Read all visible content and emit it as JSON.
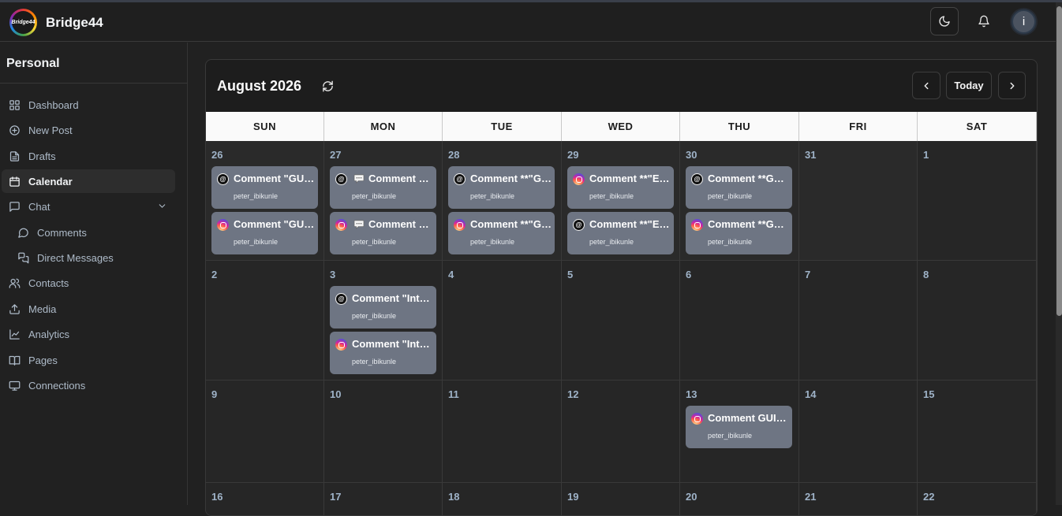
{
  "app": {
    "name": "Bridge44",
    "logo_text": "Bridge44"
  },
  "topbar": {
    "theme_toggle_icon": "moon-icon",
    "notifications_icon": "bell-icon",
    "avatar_initial": "i"
  },
  "sidebar": {
    "workspace": "Personal",
    "items": [
      {
        "label": "Dashboard",
        "icon": "grid-icon",
        "active": false,
        "sub": false
      },
      {
        "label": "New Post",
        "icon": "plus-circle-icon",
        "active": false,
        "sub": false
      },
      {
        "label": "Drafts",
        "icon": "file-icon",
        "active": false,
        "sub": false
      },
      {
        "label": "Calendar",
        "icon": "calendar-icon",
        "active": true,
        "sub": false
      },
      {
        "label": "Chat",
        "icon": "message-square-icon",
        "active": false,
        "sub": false,
        "expandable": true
      },
      {
        "label": "Comments",
        "icon": "message-circle-icon",
        "active": false,
        "sub": true
      },
      {
        "label": "Direct Messages",
        "icon": "messages-icon",
        "active": false,
        "sub": true
      },
      {
        "label": "Contacts",
        "icon": "users-icon",
        "active": false,
        "sub": false
      },
      {
        "label": "Media",
        "icon": "upload-icon",
        "active": false,
        "sub": false
      },
      {
        "label": "Analytics",
        "icon": "chart-line-icon",
        "active": false,
        "sub": false
      },
      {
        "label": "Pages",
        "icon": "book-icon",
        "active": false,
        "sub": false
      },
      {
        "label": "Connections",
        "icon": "monitor-icon",
        "active": false,
        "sub": false
      }
    ]
  },
  "calendar": {
    "month_label": "August 2026",
    "today_label": "Today",
    "weekdays": [
      "SUN",
      "MON",
      "TUE",
      "WED",
      "THU",
      "FRI",
      "SAT"
    ],
    "weeks": [
      [
        {
          "day": "26",
          "other": true,
          "events": [
            {
              "platform": "threads",
              "title": "Comment \"GUIDE",
              "user": "peter_ibikunle",
              "bubble": false
            },
            {
              "platform": "instagram",
              "title": "Comment \"GUIDE",
              "user": "peter_ibikunle",
              "bubble": false
            }
          ]
        },
        {
          "day": "27",
          "other": true,
          "events": [
            {
              "platform": "threads",
              "title": "Comment \"GUIDE",
              "user": "peter_ibikunle",
              "bubble": true
            },
            {
              "platform": "instagram",
              "title": "Comment \"GUIDE",
              "user": "peter_ibikunle",
              "bubble": true
            }
          ]
        },
        {
          "day": "28",
          "other": true,
          "events": [
            {
              "platform": "threads",
              "title": "Comment **\"GUIDE",
              "user": "peter_ibikunle",
              "bubble": false
            },
            {
              "platform": "instagram",
              "title": "Comment **\"GUIDE",
              "user": "peter_ibikunle",
              "bubble": false
            }
          ]
        },
        {
          "day": "29",
          "other": true,
          "events": [
            {
              "platform": "instagram",
              "title": "Comment **\"EXAMPLE",
              "user": "peter_ibikunle",
              "bubble": false
            },
            {
              "platform": "threads",
              "title": "Comment **\"EXAMPLE",
              "user": "peter_ibikunle",
              "bubble": false
            }
          ]
        },
        {
          "day": "30",
          "other": true,
          "events": [
            {
              "platform": "threads",
              "title": "Comment **GUIDE",
              "user": "peter_ibikunle",
              "bubble": false
            },
            {
              "platform": "instagram",
              "title": "Comment **GUIDE",
              "user": "peter_ibikunle",
              "bubble": false
            }
          ]
        },
        {
          "day": "31",
          "other": true,
          "events": []
        },
        {
          "day": "1",
          "other": false,
          "events": []
        }
      ],
      [
        {
          "day": "2",
          "events": []
        },
        {
          "day": "3",
          "events": [
            {
              "platform": "threads",
              "title": "Comment \"Interested",
              "user": "peter_ibikunle",
              "bubble": false
            },
            {
              "platform": "instagram",
              "title": "Comment \"Interested",
              "user": "peter_ibikunle",
              "bubble": false
            }
          ]
        },
        {
          "day": "4",
          "events": []
        },
        {
          "day": "5",
          "events": []
        },
        {
          "day": "6",
          "events": []
        },
        {
          "day": "7",
          "events": []
        },
        {
          "day": "8",
          "events": []
        }
      ],
      [
        {
          "day": "9",
          "events": []
        },
        {
          "day": "10",
          "events": []
        },
        {
          "day": "11",
          "events": []
        },
        {
          "day": "12",
          "events": []
        },
        {
          "day": "13",
          "events": [
            {
              "platform": "instagram",
              "title": "Comment GUIDE",
              "user": "peter_ibikunle",
              "bubble": false
            }
          ]
        },
        {
          "day": "14",
          "events": []
        },
        {
          "day": "15",
          "events": []
        }
      ],
      [
        {
          "day": "16",
          "events": []
        },
        {
          "day": "17",
          "events": []
        },
        {
          "day": "18",
          "events": []
        },
        {
          "day": "19",
          "events": []
        },
        {
          "day": "20",
          "events": []
        },
        {
          "day": "21",
          "events": []
        },
        {
          "day": "22",
          "events": []
        }
      ]
    ]
  }
}
